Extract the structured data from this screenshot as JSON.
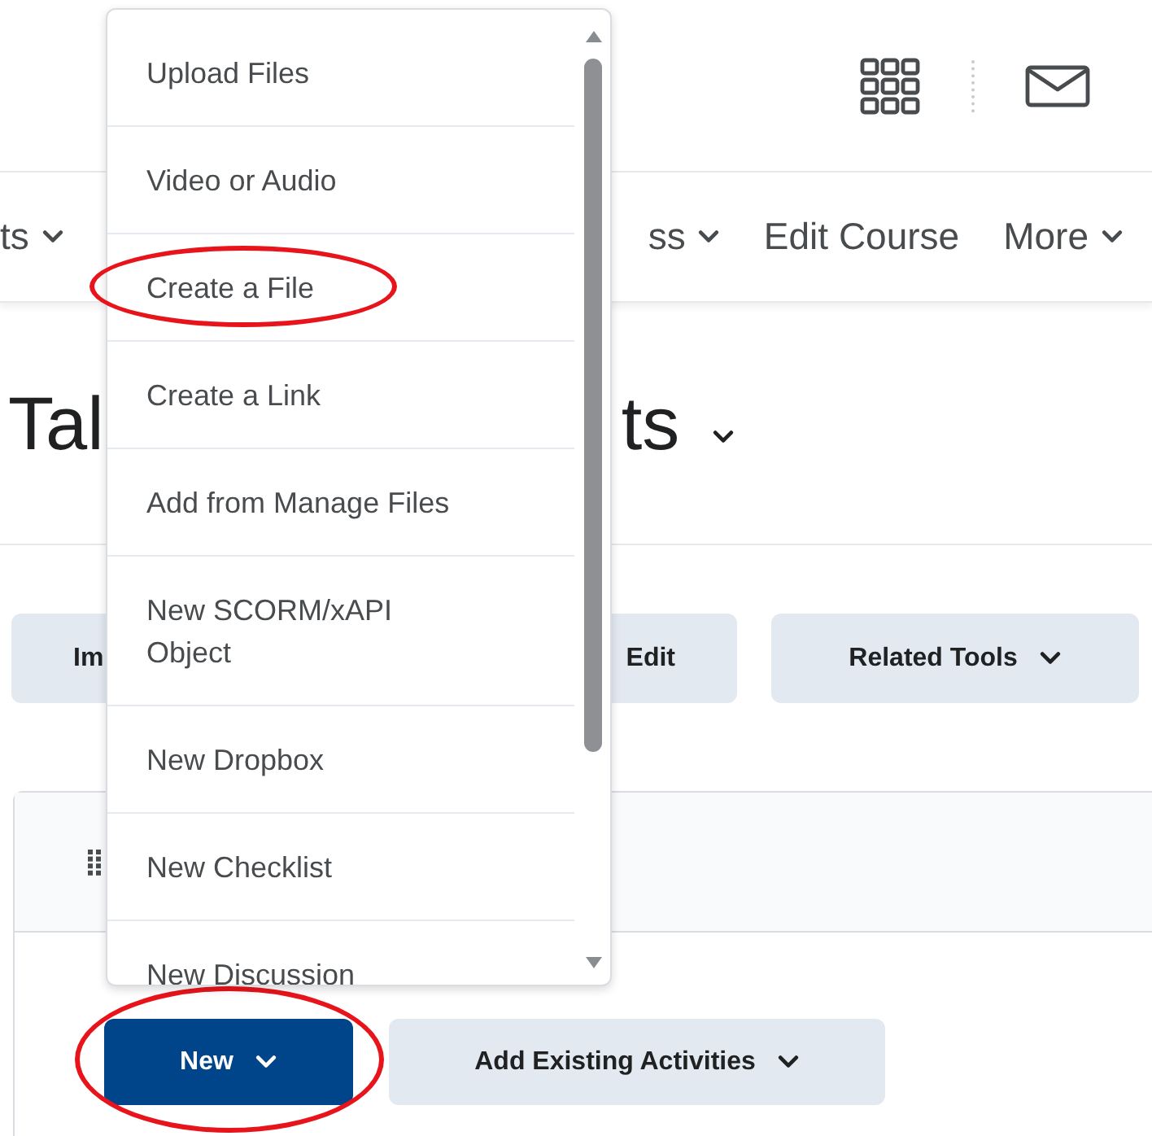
{
  "nav": {
    "items": [
      {
        "label": "ts",
        "dropdown": true
      },
      {
        "label": "ss",
        "dropdown": true
      },
      {
        "label": "Edit Course",
        "dropdown": false
      },
      {
        "label": "More",
        "dropdown": true
      }
    ]
  },
  "heading": {
    "parts": [
      "Tal",
      "ts"
    ],
    "dropdown": true
  },
  "toolbar": [
    {
      "label": "Im",
      "dropdown": false
    },
    {
      "label": "Edit",
      "dropdown": false
    },
    {
      "label": "Related Tools",
      "dropdown": true
    }
  ],
  "card": {
    "buttons": [
      {
        "label": "New",
        "kind": "primary",
        "dropdown": true,
        "circled": true
      },
      {
        "label": "Add Existing Activities",
        "kind": "secondary",
        "dropdown": true,
        "circled": false
      }
    ]
  },
  "menu": {
    "items": [
      {
        "label": "Upload Files",
        "circled": false
      },
      {
        "label": "Video or Audio",
        "circled": false
      },
      {
        "label": "Create a File",
        "circled": true
      },
      {
        "label": "Create a Link",
        "circled": false
      },
      {
        "label": "Add from Manage Files",
        "circled": false
      },
      {
        "label": "New SCORM/xAPI Object",
        "circled": false
      },
      {
        "label": "New Dropbox",
        "circled": false
      },
      {
        "label": "New Checklist",
        "circled": false
      },
      {
        "label": "New Discussion",
        "circled": false
      }
    ]
  }
}
